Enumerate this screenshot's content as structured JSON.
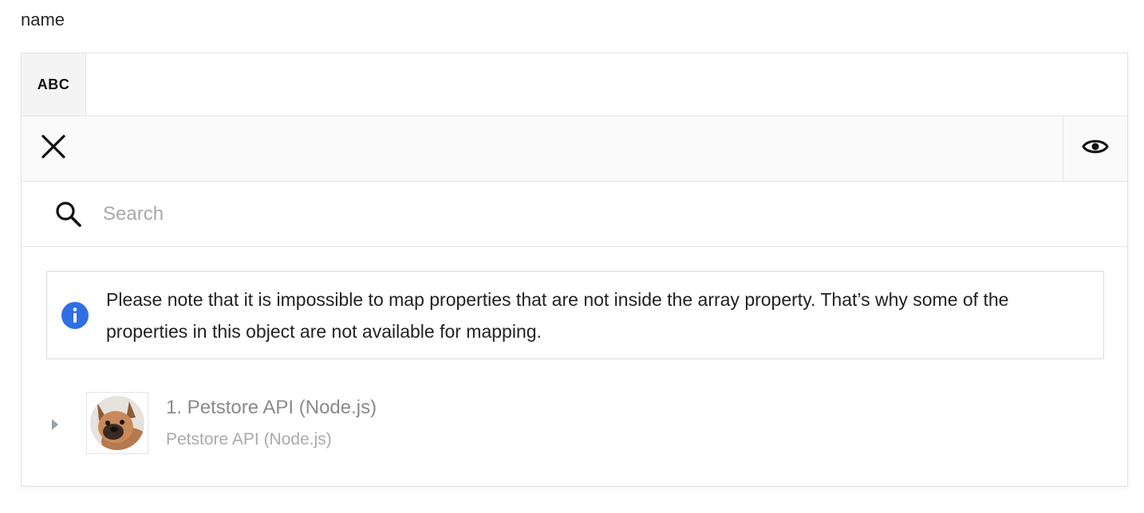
{
  "field": {
    "label": "name"
  },
  "type_row": {
    "badge": "ABC",
    "value": ""
  },
  "toolbar": {
    "clear_icon": "close-icon",
    "preview_icon": "eye-icon"
  },
  "search": {
    "icon": "search-icon",
    "placeholder": "Search",
    "value": ""
  },
  "notice": {
    "icon": "info-icon",
    "text": "Please note that it is impossible to map properties that are not inside the array property. That’s why some of the properties in this object are not available for mapping.",
    "accent_color": "#2f6fe4"
  },
  "tree": {
    "items": [
      {
        "title": "1. Petstore API (Node.js)",
        "subtitle": "Petstore API (Node.js)",
        "expand_icon": "caret-right-icon",
        "avatar": "dog-avatar"
      }
    ]
  }
}
